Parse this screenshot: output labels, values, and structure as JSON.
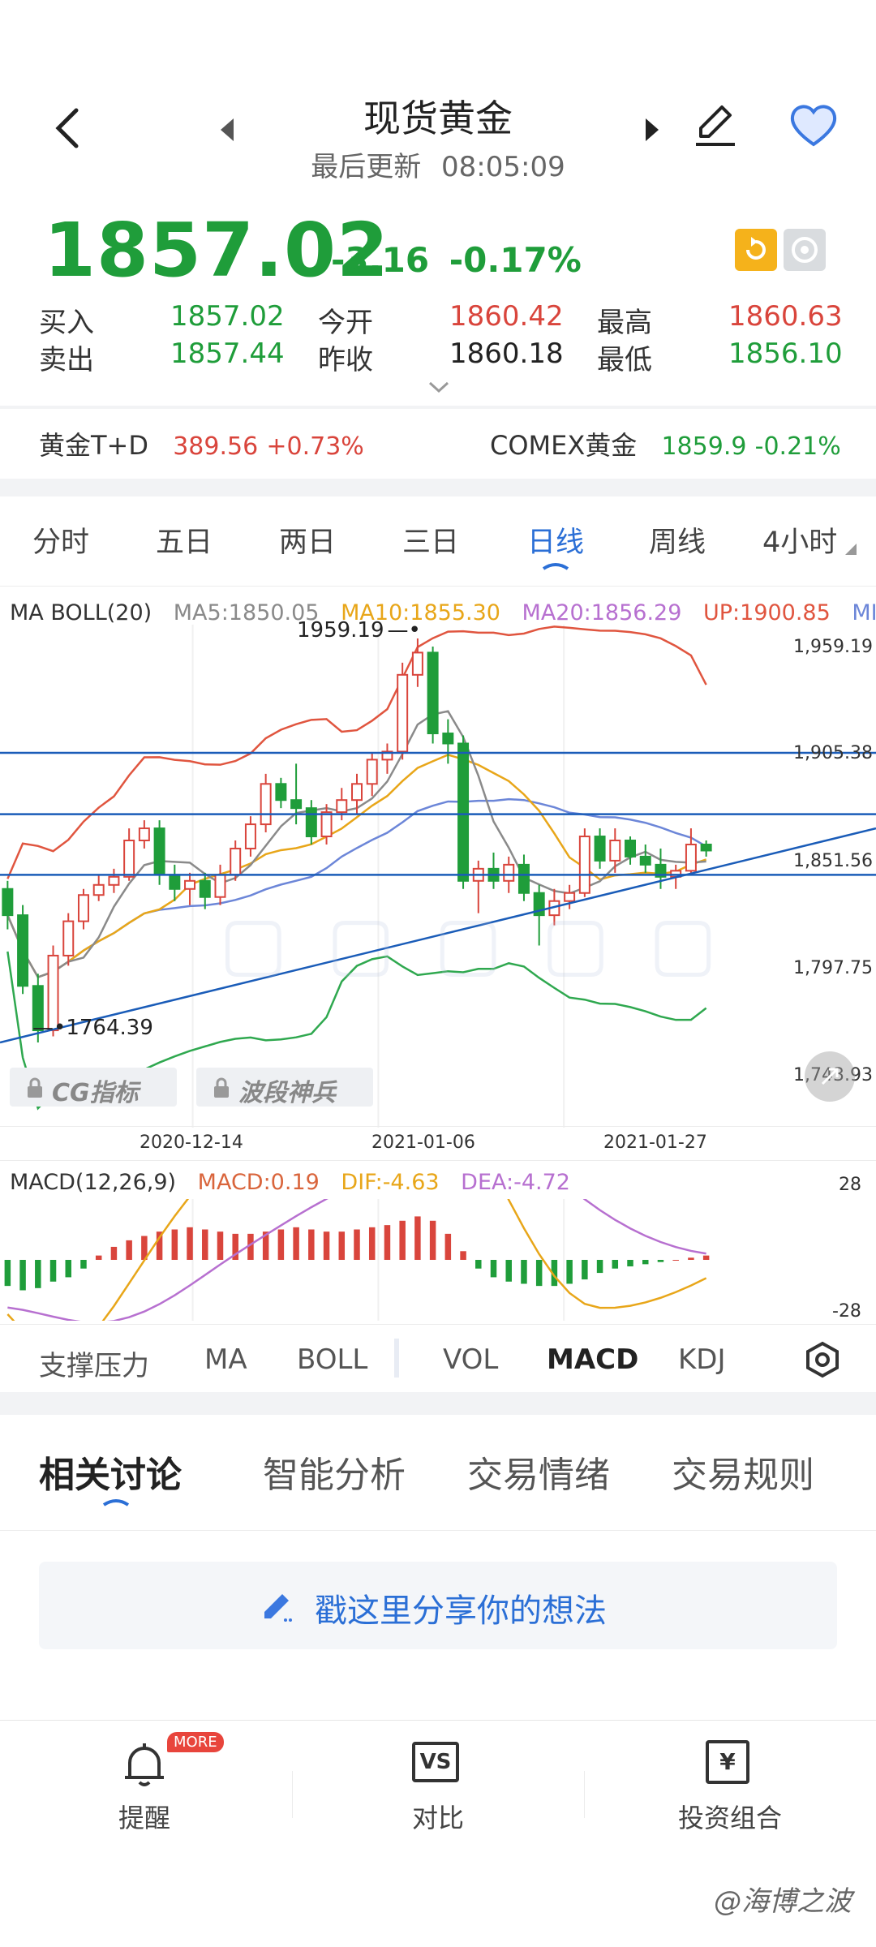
{
  "header": {
    "title": "现货黄金",
    "subtitle_label": "最后更新",
    "subtitle_time": "08:05:09"
  },
  "quote": {
    "price": "1857.02",
    "change": "-3.16",
    "change_pct": "-0.17%",
    "rows": [
      {
        "l1": "买入",
        "v1": "1857.02",
        "l2": "今开",
        "v2": "1860.42",
        "l3": "最高",
        "v3": "1860.63"
      },
      {
        "l1": "卖出",
        "v1": "1857.44",
        "l2": "昨收",
        "v2": "1860.18",
        "l3": "最低",
        "v3": "1856.10"
      }
    ]
  },
  "related": {
    "item1_name": "黄金T+D",
    "item1_value": "389.56",
    "item1_change": "+0.73%",
    "item2_name": "COMEX黄金",
    "item2_value": "1859.9",
    "item2_change": "-0.21%"
  },
  "period_tabs": [
    "分时",
    "五日",
    "两日",
    "三日",
    "日线",
    "周线",
    "4小时"
  ],
  "active_period": "日线",
  "indicator_header": {
    "name": "MA BOLL(20)",
    "ma5": "MA5:1850.05",
    "ma10": "MA10:1855.30",
    "ma20": "MA20:1856.29",
    "up": "UP:1900.85",
    "mid": "MII"
  },
  "price_axis": [
    "1,959.19",
    "1,905.38",
    "1,851.56",
    "1,797.75",
    "1,743.93"
  ],
  "max_label": "1959.19",
  "min_label": "1764.39",
  "locked": [
    "CG指标",
    "波段神兵"
  ],
  "dates": [
    "2020-12-14",
    "2021-01-06",
    "2021-01-27"
  ],
  "macd_header": {
    "name": "MACD(12,26,9)",
    "macd": "MACD:0.19",
    "dif": "DIF:-4.63",
    "dea": "DEA:-4.72"
  },
  "macd_axis": [
    "28",
    "-28"
  ],
  "toolbar": [
    "支撑压力",
    "MA",
    "BOLL",
    "VOL",
    "MACD",
    "KDJ"
  ],
  "active_tool": "MACD",
  "section_tabs": [
    "相关讨论",
    "智能分析",
    "交易情绪",
    "交易规则"
  ],
  "share_placeholder": "戳这里分享你的想法",
  "nav": [
    {
      "label": "提醒",
      "badge": "MORE"
    },
    {
      "label": "对比",
      "icon_text": "VS"
    },
    {
      "label": "投资组合",
      "icon_text": "¥"
    }
  ],
  "watermark": "@海博之波",
  "colors": {
    "up": "#d9453c",
    "down": "#1f9d3a",
    "accent": "#2b6fd6",
    "ma5": "#8a8a8a",
    "ma10": "#e8a619",
    "ma20": "#6c86d8",
    "boll_up": "#e0553f",
    "boll_low": "#2fa84f",
    "trend": "#1a5cb8"
  },
  "chart_data": {
    "type": "candlestick",
    "ohlc": [
      [
        1838,
        1842,
        1818,
        1825
      ],
      [
        1825,
        1830,
        1786,
        1790
      ],
      [
        1790,
        1796,
        1762,
        1768
      ],
      [
        1768,
        1810,
        1765,
        1805
      ],
      [
        1805,
        1826,
        1800,
        1822
      ],
      [
        1822,
        1838,
        1818,
        1835
      ],
      [
        1835,
        1845,
        1832,
        1840
      ],
      [
        1840,
        1848,
        1836,
        1844
      ],
      [
        1844,
        1868,
        1842,
        1862
      ],
      [
        1862,
        1872,
        1858,
        1868
      ],
      [
        1868,
        1872,
        1840,
        1845
      ],
      [
        1845,
        1850,
        1832,
        1838
      ],
      [
        1838,
        1846,
        1830,
        1842
      ],
      [
        1842,
        1846,
        1828,
        1834
      ],
      [
        1834,
        1850,
        1830,
        1845
      ],
      [
        1845,
        1862,
        1842,
        1858
      ],
      [
        1858,
        1874,
        1854,
        1870
      ],
      [
        1870,
        1895,
        1866,
        1890
      ],
      [
        1890,
        1893,
        1878,
        1882
      ],
      [
        1882,
        1900,
        1870,
        1878
      ],
      [
        1878,
        1882,
        1860,
        1864
      ],
      [
        1864,
        1880,
        1860,
        1876
      ],
      [
        1876,
        1888,
        1872,
        1882
      ],
      [
        1882,
        1895,
        1875,
        1890
      ],
      [
        1890,
        1905,
        1884,
        1902
      ],
      [
        1902,
        1910,
        1895,
        1906
      ],
      [
        1906,
        1950,
        1902,
        1944
      ],
      [
        1944,
        1962,
        1938,
        1955
      ],
      [
        1955,
        1958,
        1910,
        1915
      ],
      [
        1915,
        1922,
        1900,
        1910
      ],
      [
        1910,
        1914,
        1838,
        1842
      ],
      [
        1842,
        1852,
        1826,
        1848
      ],
      [
        1848,
        1856,
        1838,
        1842
      ],
      [
        1842,
        1854,
        1836,
        1850
      ],
      [
        1850,
        1855,
        1832,
        1836
      ],
      [
        1836,
        1840,
        1810,
        1825
      ],
      [
        1825,
        1838,
        1820,
        1832
      ],
      [
        1832,
        1840,
        1828,
        1836
      ],
      [
        1836,
        1868,
        1834,
        1864
      ],
      [
        1864,
        1868,
        1848,
        1852
      ],
      [
        1852,
        1868,
        1846,
        1862
      ],
      [
        1862,
        1864,
        1850,
        1854
      ],
      [
        1854,
        1860,
        1846,
        1850
      ],
      [
        1850,
        1858,
        1838,
        1844
      ],
      [
        1844,
        1850,
        1838,
        1847
      ],
      [
        1847,
        1868,
        1845,
        1860
      ],
      [
        1860,
        1862,
        1854,
        1857
      ]
    ],
    "ylim": [
      1743.93,
      1959.19
    ],
    "macd_hist": [
      -12,
      -14,
      -13,
      -10,
      -8,
      -4,
      2,
      6,
      9,
      11,
      13,
      14,
      15,
      14,
      13,
      12,
      12,
      13,
      14,
      15,
      14,
      13,
      13,
      14,
      15,
      16,
      18,
      20,
      18,
      12,
      4,
      -4,
      -8,
      -10,
      -11,
      -12,
      -12,
      -11,
      -9,
      -6,
      -4,
      -3,
      -2,
      -1,
      0,
      1,
      2
    ],
    "macd_ylim": [
      -28,
      28
    ]
  }
}
